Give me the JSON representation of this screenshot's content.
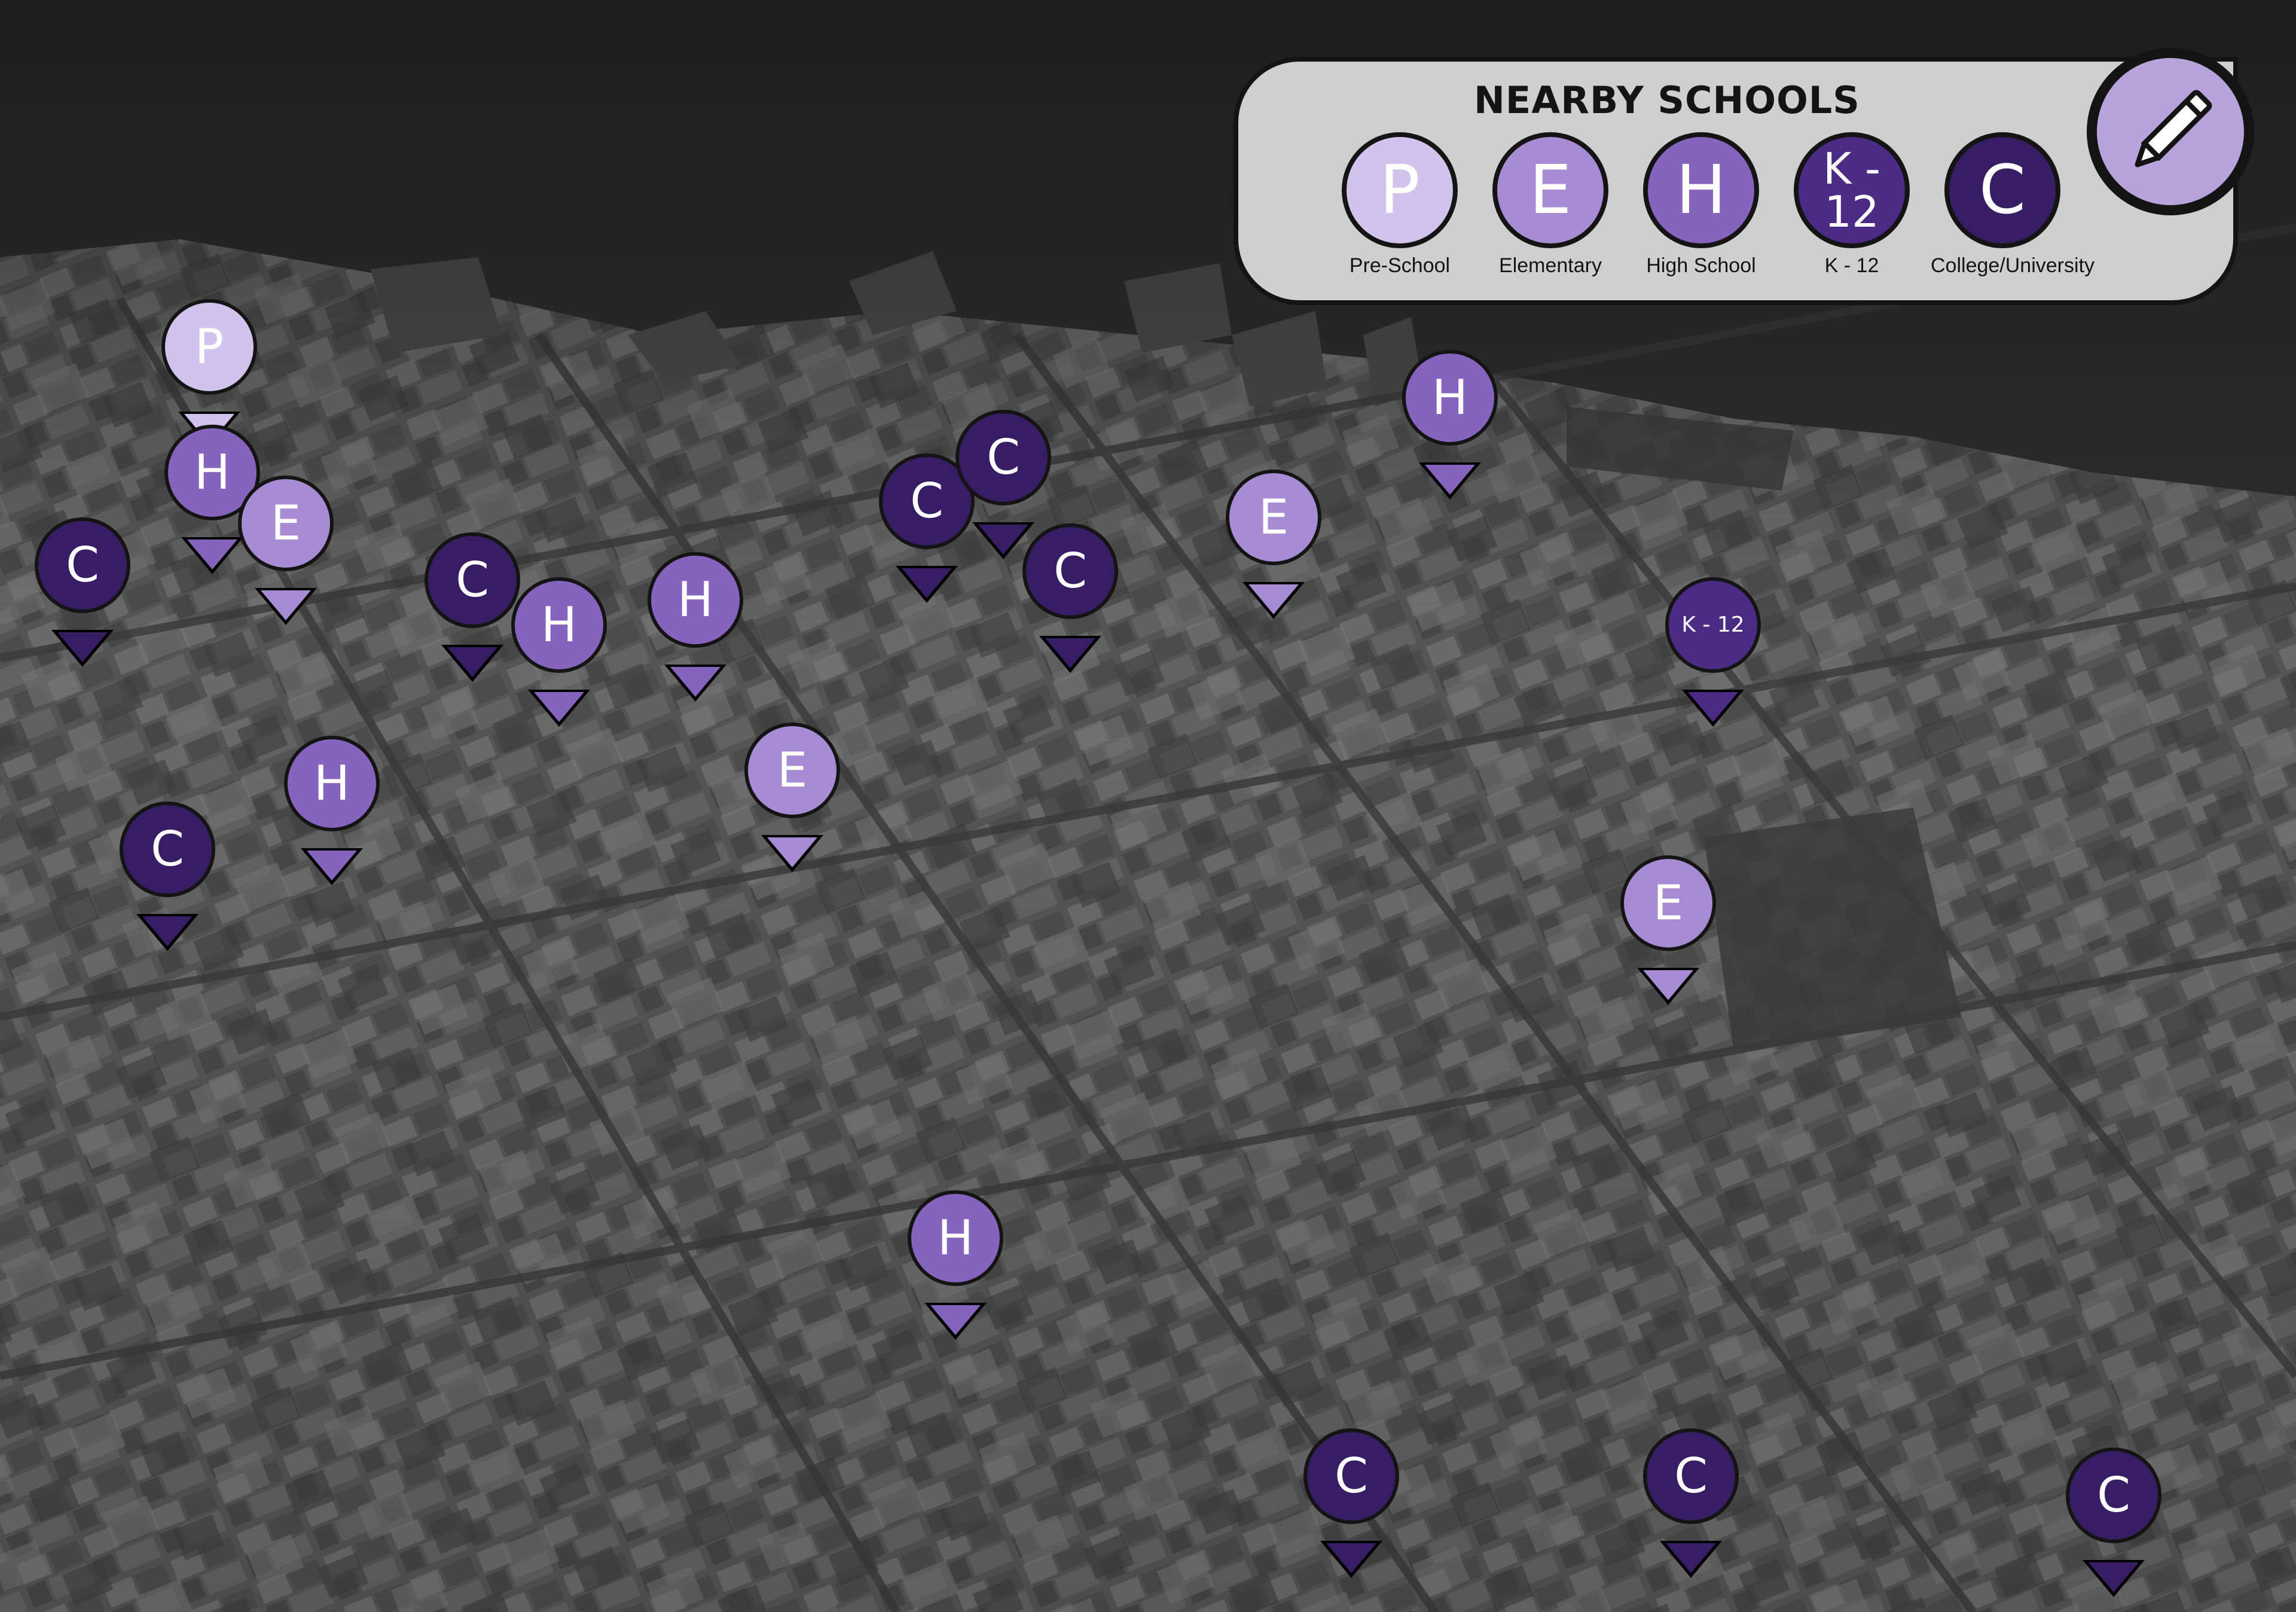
{
  "legend": {
    "title": "NEARBY SCHOOLS",
    "items": [
      {
        "type": "pre-school",
        "letter": "P",
        "label": "Pre-School",
        "color": "#d2c3ec"
      },
      {
        "type": "elementary",
        "letter": "E",
        "label": "Elementary",
        "color": "#a78cd3"
      },
      {
        "type": "high-school",
        "letter": "H",
        "label": "High School",
        "color": "#8663bd"
      },
      {
        "type": "k-12",
        "letter": "K - 12",
        "label": "K - 12",
        "color": "#4c2b86"
      },
      {
        "type": "college",
        "letter": "C",
        "label": "College/University",
        "color": "#371d63"
      }
    ]
  },
  "colors": {
    "pre-school": "#d2c3ec",
    "elementary": "#a78cd3",
    "high-school": "#8663bd",
    "k-12": "#4c2b86",
    "college": "#371d63",
    "water": "#2e2e2e",
    "city": "#5a5a5a",
    "outline": "#141414"
  },
  "edit_icon": "pencil-icon",
  "markers": [
    {
      "letter": "P",
      "type": "pre-school"
    },
    {
      "letter": "H",
      "type": "high-school"
    },
    {
      "letter": "E",
      "type": "elementary"
    },
    {
      "letter": "C",
      "type": "college"
    },
    {
      "letter": "C",
      "type": "college"
    },
    {
      "letter": "H",
      "type": "high-school"
    },
    {
      "letter": "H",
      "type": "high-school"
    },
    {
      "letter": "C",
      "type": "college"
    },
    {
      "letter": "C",
      "type": "college"
    },
    {
      "letter": "C",
      "type": "college"
    },
    {
      "letter": "E",
      "type": "elementary"
    },
    {
      "letter": "H",
      "type": "high-school"
    },
    {
      "letter": "K - 12",
      "type": "k-12"
    },
    {
      "letter": "E",
      "type": "elementary"
    },
    {
      "letter": "H",
      "type": "high-school"
    },
    {
      "letter": "C",
      "type": "college"
    },
    {
      "letter": "E",
      "type": "elementary"
    },
    {
      "letter": "H",
      "type": "high-school"
    },
    {
      "letter": "C",
      "type": "college"
    },
    {
      "letter": "C",
      "type": "college"
    },
    {
      "letter": "C",
      "type": "college"
    }
  ]
}
